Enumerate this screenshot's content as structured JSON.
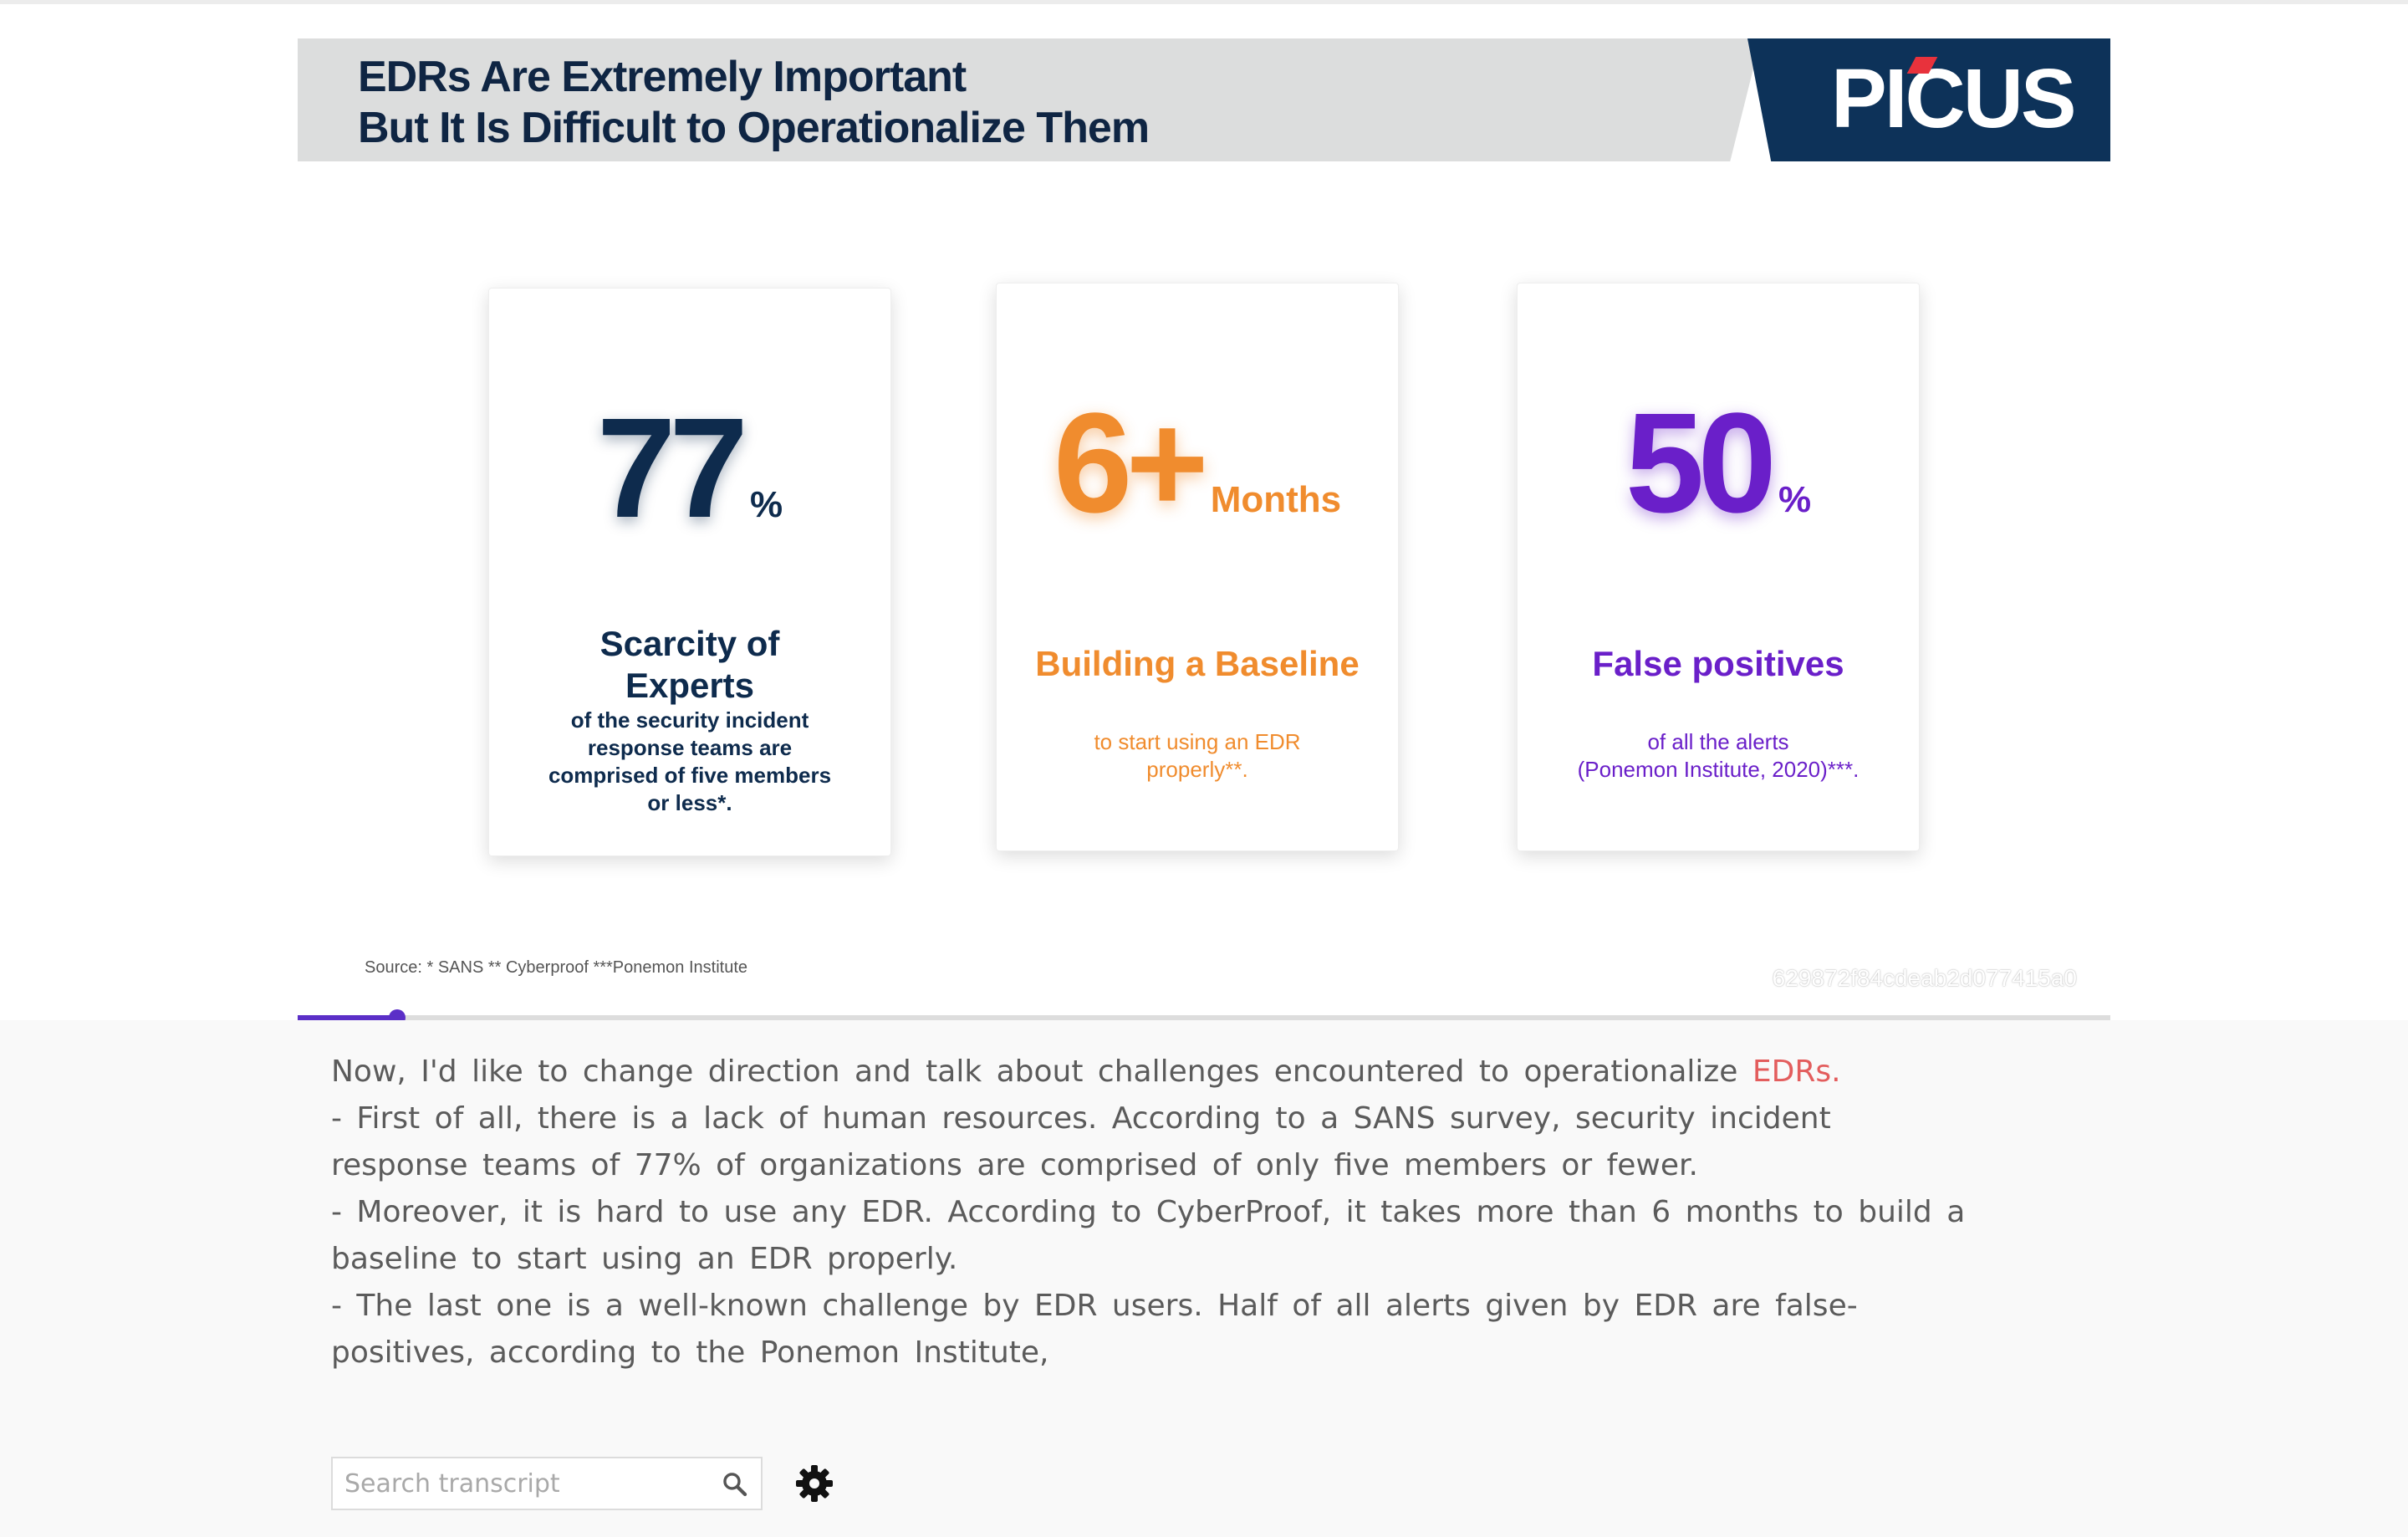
{
  "slide": {
    "title_lines": [
      "EDRs Are Extremely Important",
      "But It Is Difficult to Operationalize Them"
    ],
    "logo": "PICUS",
    "cards": [
      {
        "stat": "77",
        "unit": "%",
        "heading_lines": [
          "Scarcity of",
          "Experts"
        ],
        "desc_lines": [
          "of the security incident",
          "response teams are",
          "comprised of five members",
          "or less*."
        ]
      },
      {
        "stat": "6+",
        "unit": "Months",
        "heading_lines": [
          "Building a Baseline"
        ],
        "desc_lines": [
          "to start using an EDR",
          "properly**."
        ]
      },
      {
        "stat": "50",
        "unit": "%",
        "heading_lines": [
          "False positives"
        ],
        "desc_lines": [
          "of all the alerts",
          "(Ponemon Institute, 2020)***."
        ]
      }
    ],
    "source": "Source: * SANS ** Cyberproof ***Ponemon Institute",
    "watermark": "629872f84cdeab2d077415a0"
  },
  "player": {
    "progress": 0.055
  },
  "transcript": {
    "first_line_text": "Now, I'd like to change direction and talk about challenges encountered to operationalize ",
    "first_line_highlight": "EDRs.",
    "lines": [
      "- First of all, there is a lack of human resources. According to a SANS survey, security incident",
      "response teams of 77% of organizations are comprised of only five members or fewer.",
      "- Moreover, it is hard to use any EDR. According to CyberProof,  it takes more than 6 months to build a",
      "baseline to start using an EDR  properly.",
      "- The last one is a well-known challenge by EDR  users. Half of all alerts given by EDR are false-",
      "positives,   according to the Ponemon Institute,"
    ],
    "search_placeholder": "Search transcript"
  },
  "icons": {
    "search": "search-icon",
    "settings": "gear-icon"
  },
  "colors": {
    "navy": "#0e2b4d",
    "orange": "#f08c2e",
    "purple": "#6a1fc9",
    "progress": "#5b2fc7",
    "highlight": "#e35d5d",
    "logo_bg": "#0d3259"
  }
}
